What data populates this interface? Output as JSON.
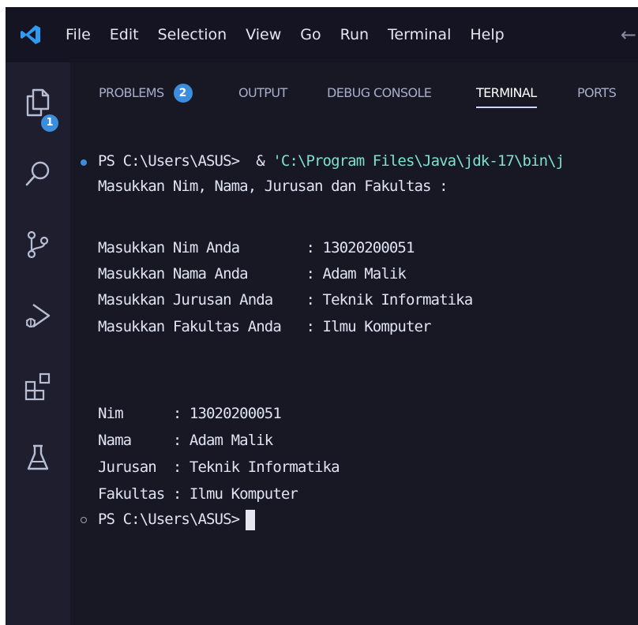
{
  "menu": {
    "items": [
      "File",
      "Edit",
      "Selection",
      "View",
      "Go",
      "Run",
      "Terminal",
      "Help"
    ]
  },
  "activity": {
    "explorer_badge": "1"
  },
  "panel": {
    "tabs": {
      "problems": "PROBLEMS",
      "problems_count": "2",
      "output": "OUTPUT",
      "debug_console": "DEBUG CONSOLE",
      "terminal": "TERMINAL",
      "ports": "PORTS"
    },
    "active_tab": "TERMINAL"
  },
  "terminal": {
    "prompt1": "PS C:\\Users\\ASUS> ",
    "command_op": " & ",
    "command_path": "'C:\\Program Files\\Java\\jdk-17\\bin\\j",
    "line_intro": "Masukkan Nim, Nama, Jurusan dan Fakultas :",
    "input_lines": [
      "Masukkan Nim Anda        : 13020200051",
      "Masukkan Nama Anda       : Adam Malik",
      "Masukkan Jurusan Anda    : Teknik Informatika",
      "Masukkan Fakultas Anda   : Ilmu Komputer"
    ],
    "output_lines": [
      "Nim      : 13020200051",
      "Nama     : Adam Malik",
      "Jurusan  : Teknik Informatika",
      "Fakultas : Ilmu Komputer"
    ],
    "prompt2": "PS C:\\Users\\ASUS>"
  },
  "colors": {
    "accent": "#3b8ede",
    "background": "#181825",
    "path_text": "#7fe0d0"
  }
}
